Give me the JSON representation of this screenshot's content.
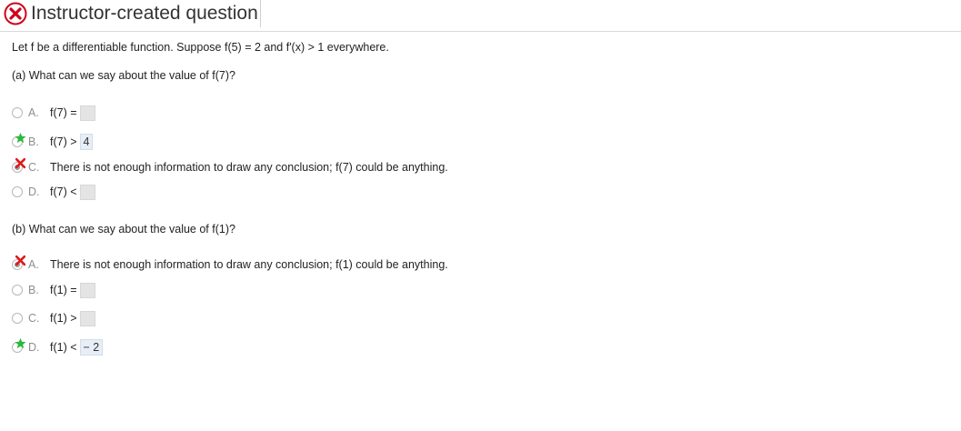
{
  "header": {
    "title": "Instructor-created question",
    "status_icon": "incorrect-x-icon",
    "status_color": "#d0021b"
  },
  "question": {
    "stem": "Let f be a differentiable function. Suppose f(5) = 2 and f′(x) > 1 everywhere."
  },
  "part_a": {
    "prompt": "(a) What can we say about the value of f(7)?",
    "options": [
      {
        "letter": "A.",
        "text": "f(7) =",
        "answer": "",
        "selected": false,
        "mark": "none"
      },
      {
        "letter": "B.",
        "text": "f(7) >",
        "answer": "4",
        "selected": false,
        "mark": "correct-star"
      },
      {
        "letter": "C.",
        "text": "There is not enough information to draw any conclusion; f(7) could be anything.",
        "selected": true,
        "mark": "incorrect-x"
      },
      {
        "letter": "D.",
        "text": "f(7) <",
        "answer": "",
        "selected": false,
        "mark": "none"
      }
    ]
  },
  "part_b": {
    "prompt": "(b) What can we say about the value of f(1)?",
    "options": [
      {
        "letter": "A.",
        "text": "There is not enough information to draw any conclusion; f(1) could be anything.",
        "selected": true,
        "mark": "incorrect-x"
      },
      {
        "letter": "B.",
        "text": "f(1) =",
        "answer": "",
        "selected": false,
        "mark": "none"
      },
      {
        "letter": "C.",
        "text": "f(1) >",
        "answer": "",
        "selected": false,
        "mark": "none"
      },
      {
        "letter": "D.",
        "text": "f(1) <",
        "answer": "− 2",
        "selected": false,
        "mark": "correct-star"
      }
    ]
  },
  "colors": {
    "correct_star": "#2db83d",
    "incorrect_x": "#e0191b",
    "answer_box_bg": "#e7eef7"
  }
}
